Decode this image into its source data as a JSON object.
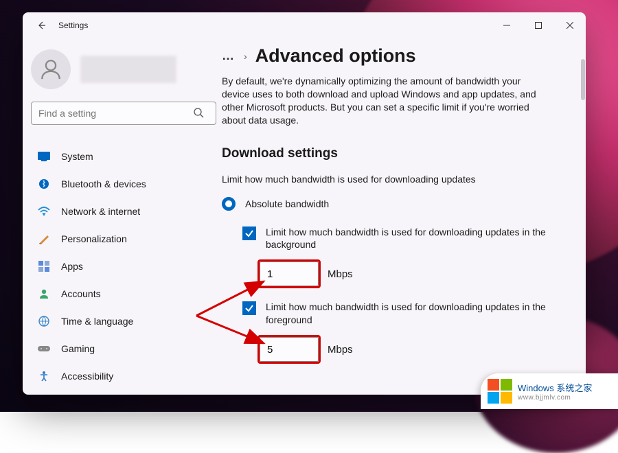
{
  "app": {
    "title": "Settings"
  },
  "search": {
    "placeholder": "Find a setting"
  },
  "sidebar": {
    "items": [
      {
        "icon": "display-icon",
        "label": "System"
      },
      {
        "icon": "bluetooth-icon",
        "label": "Bluetooth & devices"
      },
      {
        "icon": "wifi-icon",
        "label": "Network & internet"
      },
      {
        "icon": "brush-icon",
        "label": "Personalization"
      },
      {
        "icon": "apps-icon",
        "label": "Apps"
      },
      {
        "icon": "person-icon",
        "label": "Accounts"
      },
      {
        "icon": "globe-icon",
        "label": "Time & language"
      },
      {
        "icon": "gamepad-icon",
        "label": "Gaming"
      },
      {
        "icon": "accessibility-icon",
        "label": "Accessibility"
      }
    ]
  },
  "breadcrumb": {
    "ellipsis": "…",
    "chevron": "›",
    "page_title": "Advanced options"
  },
  "content": {
    "description": "By default, we're dynamically optimizing the amount of bandwidth your device uses to both download and upload Windows and app updates, and other Microsoft products. But you can set a specific limit if you're worried about data usage.",
    "section_heading": "Download settings",
    "subheading": "Limit how much bandwidth is used for downloading updates",
    "radio_absolute": "Absolute bandwidth",
    "bg_limit": {
      "label": "Limit how much bandwidth is used for downloading updates in the background",
      "value": "1",
      "unit": "Mbps"
    },
    "fg_limit": {
      "label": "Limit how much bandwidth is used for downloading updates in the foreground",
      "value": "5",
      "unit": "Mbps"
    }
  },
  "watermark": {
    "line1_a": "Windows ",
    "line1_b": "系统之家",
    "line2": "www.bjjmlv.com"
  },
  "colors": {
    "accent": "#0067c0",
    "annotation": "#d40000"
  }
}
